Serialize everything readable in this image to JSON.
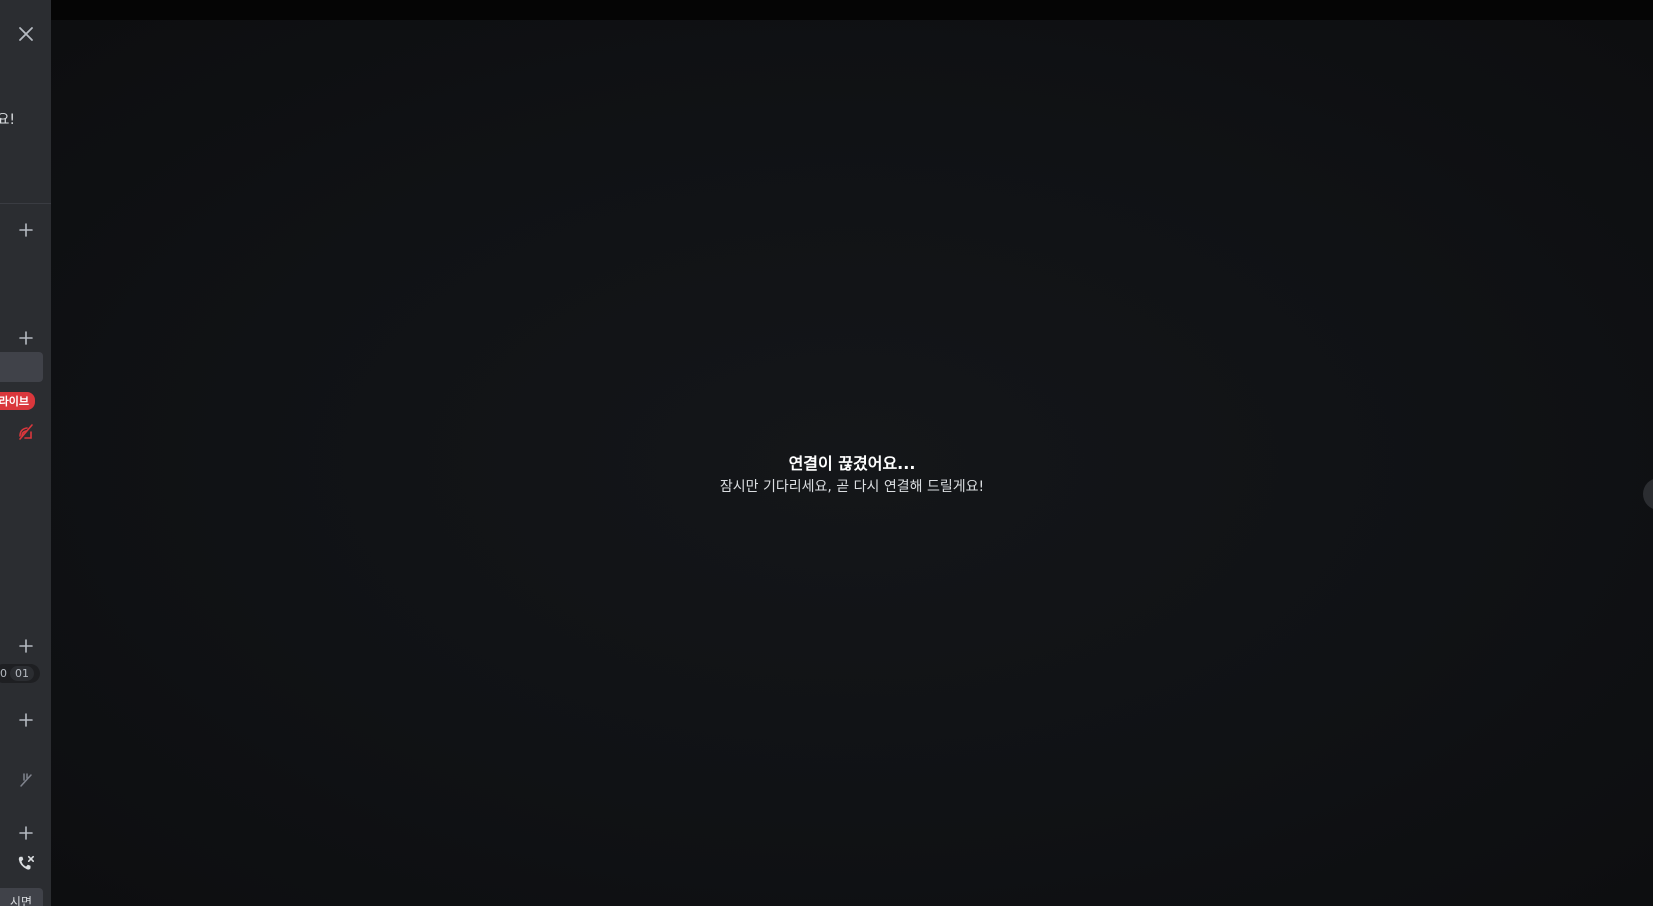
{
  "sidebar": {
    "notice_text": "요!",
    "live_badge": "라이브",
    "counter_a": "0",
    "counter_b": "01",
    "bottom_text": "시면"
  },
  "main": {
    "title": "연결이 끊겼어요...",
    "subtitle": "잠시만 기다리세요, 곧 다시 연결해 드릴게요!"
  },
  "colors": {
    "sidebar_bg": "#2b2d31",
    "main_bg": "#101215",
    "live_red": "#da373c",
    "icon_gray": "#b5bac1"
  },
  "icons": {
    "close": "close-icon",
    "add": "plus-icon",
    "stream_off": "stream-off-icon",
    "mic_off": "mic-off-icon",
    "call_end": "call-end-icon",
    "chevron": "chevron-left-icon",
    "members": "members-icon"
  }
}
